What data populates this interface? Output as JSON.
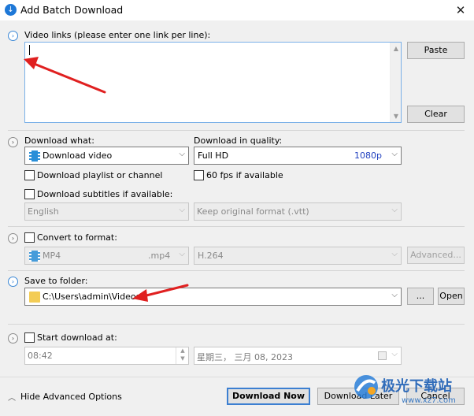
{
  "window": {
    "title": "Add Batch Download",
    "close_glyph": "✕"
  },
  "links": {
    "label": "Video links (please enter one link per line):",
    "value": "",
    "paste_label": "Paste",
    "clear_label": "Clear"
  },
  "download": {
    "what_label": "Download what:",
    "what_value": "Download video",
    "quality_label": "Download in quality:",
    "quality_value": "Full HD",
    "quality_badge": "1080p",
    "playlist_label": "Download playlist or channel",
    "fps_label": "60 fps if available",
    "subtitles_label": "Download subtitles if available:",
    "subtitle_lang": "English",
    "subtitle_format": "Keep original format (.vtt)"
  },
  "convert": {
    "label": "Convert to format:",
    "format_value": "MP4",
    "format_ext": ".mp4",
    "codec_value": "H.264",
    "advanced_label": "Advanced..."
  },
  "save": {
    "label": "Save to folder:",
    "folder": "C:\\Users\\admin\\Videos",
    "browse_label": "...",
    "open_label": "Open"
  },
  "schedule": {
    "label": "Start download at:",
    "time": "08:42",
    "date": "星期三，  三月   08, 2023"
  },
  "footer": {
    "hide_label": "Hide Advanced Options",
    "download_now": "Download Now",
    "download_later": "Download Later",
    "cancel": "Cancel"
  },
  "watermark": {
    "text": "极光下载站",
    "url": "www.xz7.com"
  },
  "colors": {
    "accent": "#1e78d7",
    "quality_badge": "#1f3fbf",
    "annotation_arrow": "#e02020"
  },
  "icons": {
    "app": "download-icon",
    "expand": "chevron-right-circle-icon",
    "collapse": "chevron-up-icon",
    "format": "film-icon",
    "folder": "folder-icon"
  }
}
